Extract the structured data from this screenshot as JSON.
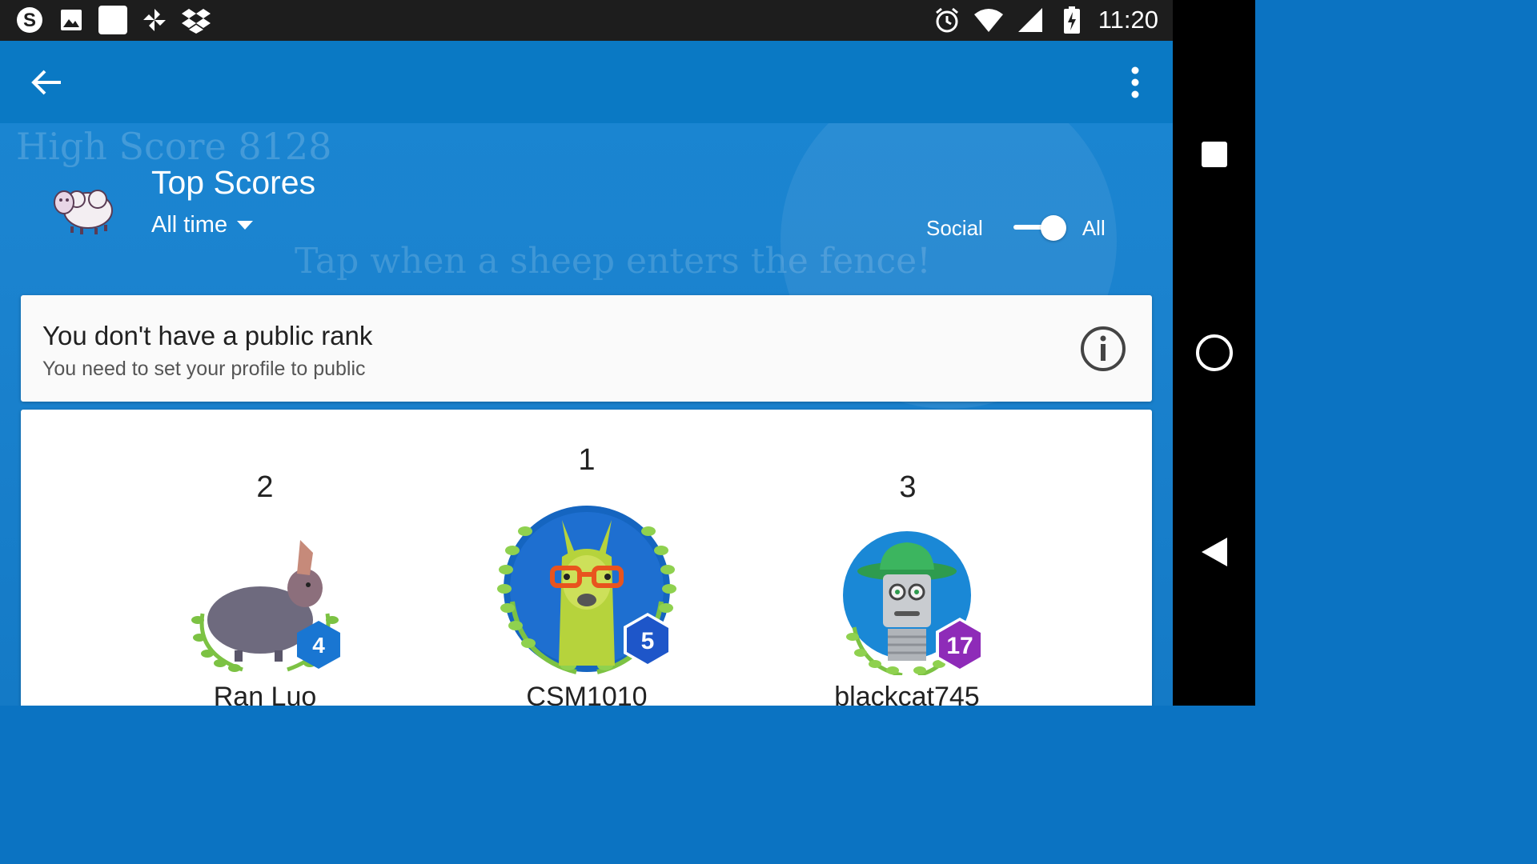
{
  "status_bar": {
    "time": "11:20",
    "left_icons": [
      "skype-icon",
      "image-icon",
      "notification-square-icon",
      "pinwheel-icon",
      "dropbox-icon"
    ],
    "right_icons": [
      "alarm-icon",
      "wifi-icon",
      "signal-icon",
      "battery-charging-icon"
    ]
  },
  "background": {
    "line1": "High Score  8128",
    "line2": "Tap when a sheep enters the fence!"
  },
  "toolbar": {
    "back_icon": "arrow-back-icon",
    "menu_icon": "more-vert-icon"
  },
  "leaderboard": {
    "title": "Top Scores",
    "timeframe": "All time",
    "toggle": {
      "left": "Social",
      "right": "All",
      "selected": "All"
    }
  },
  "rank_card": {
    "title": "You don't have a public rank",
    "subtitle": "You need to set your profile to public"
  },
  "podium": [
    {
      "rank": "2",
      "name": "Ran Luo",
      "level": "4",
      "badge_color": "#1976d2"
    },
    {
      "rank": "1",
      "name": "CSM1010",
      "level": "5",
      "badge_color": "#1e56c9"
    },
    {
      "rank": "3",
      "name": "blackcat745",
      "level": "17",
      "badge_color": "#8e2bb8"
    }
  ],
  "colors": {
    "app_blue": "#1b83cf",
    "toolbar_blue": "#0a79c4",
    "status_bar": "#1d1d1d",
    "nav_bar": "#000000"
  }
}
